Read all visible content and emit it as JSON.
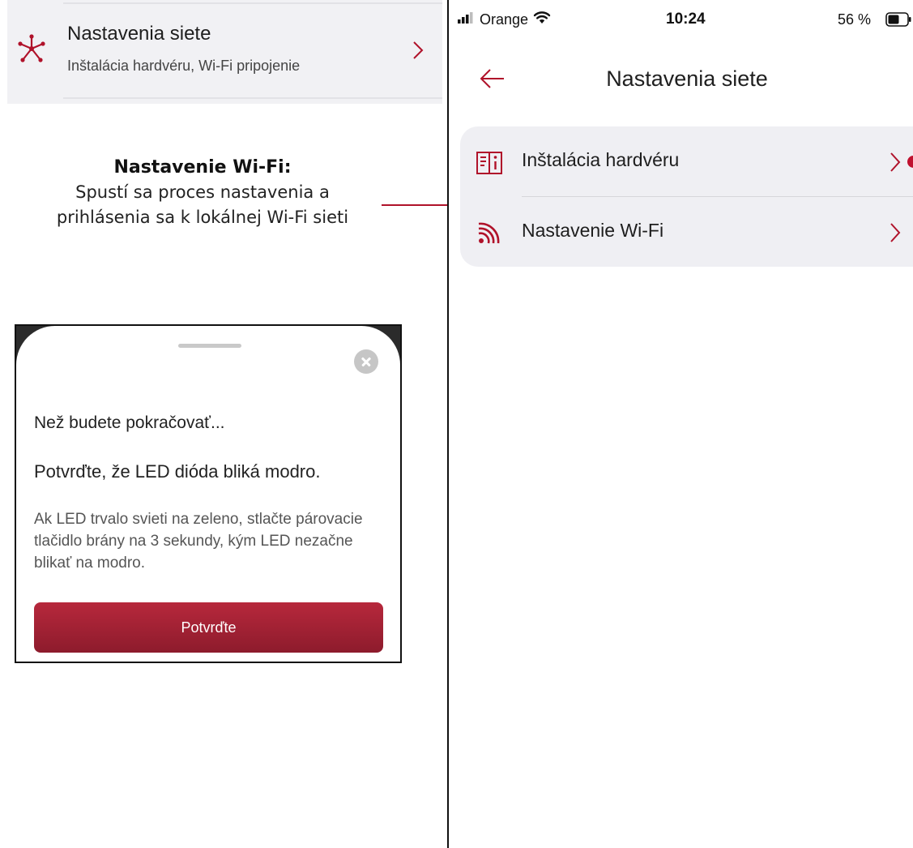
{
  "context_row": {
    "title": "Nastavenia siete",
    "subtitle": "Inštalácia hardvéru, Wi-Fi pripojenie",
    "icon": "network-icon"
  },
  "annotation": {
    "title": "Nastavenie Wi-Fi:",
    "text": "Spustí sa proces nastavenia a prihlásenia sa k lokálnej Wi-Fi sieti"
  },
  "sheet": {
    "heading": "Než budete pokračovať...",
    "confirm_text": "Potvrďte, že LED dióda bliká modro.",
    "help_text": "Ak LED trvalo svieti na zeleno, stlačte párovacie tlačidlo brány na 3 sekundy, kým LED nezačne blikať na modro.",
    "button_label": "Potvrďte"
  },
  "status_bar": {
    "carrier": "Orange",
    "time": "10:24",
    "battery": "56 %"
  },
  "nav": {
    "title": "Nastavenia siete"
  },
  "menu": {
    "items": [
      {
        "label": "Inštalácia hardvéru",
        "icon": "manual-info-icon"
      },
      {
        "label": "Nastavenie Wi-Fi",
        "icon": "wifi-signal-icon"
      }
    ]
  },
  "colors": {
    "accent": "#b0122a",
    "button": "#a52234",
    "group_background": "#efeff3"
  }
}
